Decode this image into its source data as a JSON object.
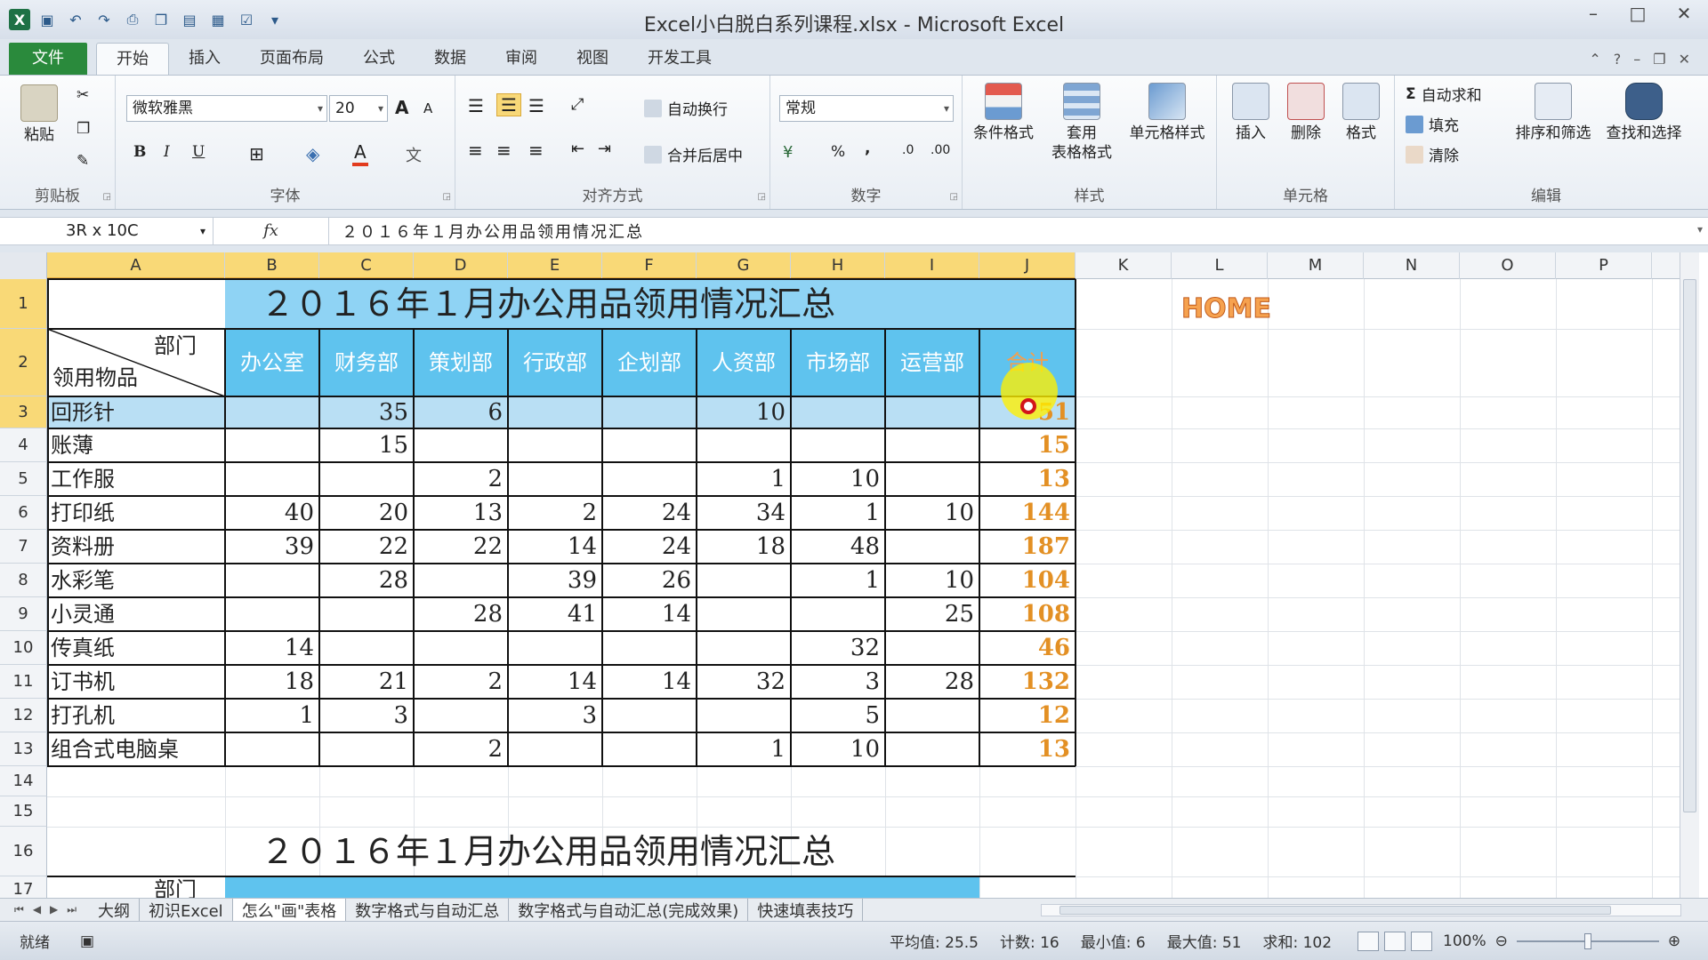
{
  "window": {
    "title": "Excel小白脱白系列课程.xlsx - Microsoft Excel",
    "minimize_icon": "minimize-icon",
    "maximize_icon": "maximize-icon",
    "close_icon": "close-icon"
  },
  "quick_access": [
    "save-icon",
    "undo-icon",
    "redo-icon",
    "print-preview-icon"
  ],
  "ribbon_tabs": [
    "文件",
    "开始",
    "插入",
    "页面布局",
    "公式",
    "数据",
    "审阅",
    "视图",
    "开发工具"
  ],
  "ribbon": {
    "clipboard": {
      "label": "剪贴板",
      "paste": "粘贴"
    },
    "font": {
      "label": "字体",
      "name": "微软雅黑",
      "size": "20",
      "bold": "B",
      "italic": "I",
      "underline": "U",
      "grow": "A",
      "shrink": "A"
    },
    "alignment": {
      "label": "对齐方式",
      "wrap_text": "自动换行",
      "merge_center": "合并后居中"
    },
    "number": {
      "label": "数字",
      "format": "常规",
      "percent": "%",
      "comma": ","
    },
    "styles": {
      "label": "样式",
      "conditional": "条件格式",
      "table_format_1": "套用",
      "table_format_2": "表格格式",
      "cell_styles": "单元格样式"
    },
    "cells": {
      "label": "单元格",
      "insert": "插入",
      "delete": "删除",
      "format": "格式"
    },
    "editing": {
      "label": "编辑",
      "autosum": "自动求和",
      "fill": "填充",
      "clear": "清除",
      "sort_filter": "排序和筛选",
      "find_select": "查找和选择"
    }
  },
  "formula_bar": {
    "name_box": "3R x 10C",
    "fx": "fx",
    "content": "２０１６年１月办公用品领用情况汇总"
  },
  "columns": [
    "A",
    "B",
    "C",
    "D",
    "E",
    "F",
    "G",
    "H",
    "I",
    "J",
    "K",
    "L",
    "M",
    "N",
    "O",
    "P"
  ],
  "rows": [
    "1",
    "2",
    "3",
    "4",
    "5",
    "6",
    "7",
    "8",
    "9",
    "10",
    "11",
    "12",
    "13",
    "14",
    "15",
    "16",
    "17"
  ],
  "table": {
    "title": "２０１６年１月办公用品领用情况汇总",
    "corner_top": "部门",
    "corner_bottom": "领用物品",
    "headers": [
      "办公室",
      "财务部",
      "策划部",
      "行政部",
      "企划部",
      "人资部",
      "市场部",
      "运营部",
      "合计"
    ],
    "rows": [
      {
        "item": "回形针",
        "values": [
          "",
          "35",
          "6",
          "",
          "",
          "10",
          "",
          "",
          "51"
        ]
      },
      {
        "item": "账薄",
        "values": [
          "",
          "15",
          "",
          "",
          "",
          "",
          "",
          "",
          "15"
        ]
      },
      {
        "item": "工作服",
        "values": [
          "",
          "",
          "2",
          "",
          "",
          "1",
          "10",
          "",
          "13"
        ]
      },
      {
        "item": "打印纸",
        "values": [
          "40",
          "20",
          "13",
          "2",
          "24",
          "34",
          "1",
          "10",
          "144"
        ]
      },
      {
        "item": "资料册",
        "values": [
          "39",
          "22",
          "22",
          "14",
          "24",
          "18",
          "48",
          "",
          "187"
        ]
      },
      {
        "item": "水彩笔",
        "values": [
          "",
          "28",
          "",
          "39",
          "26",
          "",
          "1",
          "10",
          "104"
        ]
      },
      {
        "item": "小灵通",
        "values": [
          "",
          "",
          "28",
          "41",
          "14",
          "",
          "",
          "25",
          "108"
        ]
      },
      {
        "item": "传真纸",
        "values": [
          "14",
          "",
          "",
          "",
          "",
          "",
          "32",
          "",
          "46"
        ]
      },
      {
        "item": "订书机",
        "values": [
          "18",
          "21",
          "2",
          "14",
          "14",
          "32",
          "3",
          "28",
          "132"
        ]
      },
      {
        "item": "打孔机",
        "values": [
          "1",
          "3",
          "",
          "3",
          "",
          "",
          "5",
          "",
          "12"
        ]
      },
      {
        "item": "组合式电脑桌",
        "values": [
          "",
          "",
          "2",
          "",
          "",
          "1",
          "10",
          "",
          "13"
        ]
      }
    ]
  },
  "table2": {
    "title": "２０１６年１月办公用品领用情况汇总",
    "corner_top": "部门"
  },
  "home_label": "HOME",
  "sheets": [
    "大纲",
    "初识Excel",
    "怎么\"画\"表格",
    "数字格式与自动汇总",
    "数字格式与自动汇总(完成效果)",
    "快速填表技巧"
  ],
  "status": {
    "ready": "就绪",
    "average": "平均值: 25.5",
    "count": "计数: 16",
    "min": "最小值: 6",
    "max": "最大值: 51",
    "sum": "求和: 102",
    "zoom": "100%"
  },
  "colors": {
    "header_blue": "#5fc3ee",
    "header_light": "#8fd3f4",
    "total_orange": "#e39024",
    "selection": "#f9d977",
    "accent_green": "#2a8a3c"
  }
}
